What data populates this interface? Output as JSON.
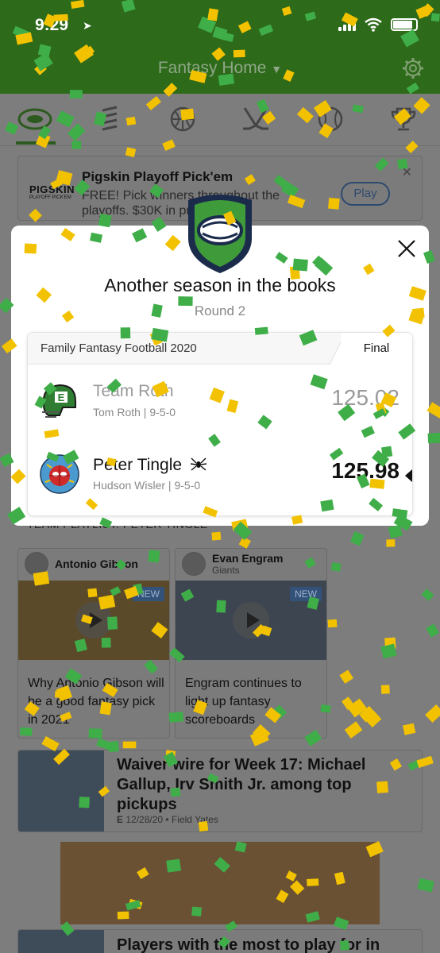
{
  "status_bar": {
    "time": "9:29"
  },
  "header": {
    "title": "Fantasy Home"
  },
  "tabs": [
    {
      "name": "football",
      "icon": "football-icon",
      "active": true
    },
    {
      "name": "sportsbook",
      "icon": "slash-icon"
    },
    {
      "name": "basketball",
      "icon": "basketball-icon"
    },
    {
      "name": "hockey",
      "icon": "hockey-icon"
    },
    {
      "name": "baseball",
      "icon": "baseball-icon"
    },
    {
      "name": "trophy",
      "icon": "trophy-icon"
    }
  ],
  "promo": {
    "logo": "PIGSKIN",
    "logo_sub": "PLAYOFF PICK'EM",
    "title": "Pigskin Playoff Pick'em",
    "text": "FREE! Pick winners throughout the playoffs. $30K in prizes!",
    "button": "Play"
  },
  "modal": {
    "title": "Another season in the books",
    "subtitle": "Round 2",
    "league": "Family Fantasy Football 2020",
    "status": "Final",
    "teams": [
      {
        "name": "Team Roth",
        "owner": "Tom Roth",
        "record": "9-5-0",
        "score": "125.02",
        "result": "loss"
      },
      {
        "name": "Peter Tingle",
        "owner": "Hudson Wisler",
        "record": "9-5-0",
        "score": "125.98",
        "result": "win"
      }
    ]
  },
  "playlist": {
    "label": "TEAM PLAYLIST: PETER TINGLE"
  },
  "news": [
    {
      "player": "Antonio Gibson",
      "team": "",
      "badge": "NEW",
      "headline": "Why Antonio Gibson will be a good fantasy pick in 2021"
    },
    {
      "player": "Evan Engram",
      "team": "Giants",
      "badge": "NEW",
      "headline": "Engram continues to light up fantasy scoreboards"
    }
  ],
  "article": {
    "title": "Waiver wire for Week 17: Michael Gallup, Irv Smith Jr. among top pickups",
    "date": "12/28/20",
    "author": "Field Yates"
  },
  "bottom_article": {
    "title": "Players with the most to play for in"
  },
  "colors": {
    "header_green": "#2d6a1a",
    "confetti_yellow": "#f2c200",
    "confetti_green": "#3fae49",
    "accent_navy": "#1b2b4b"
  }
}
